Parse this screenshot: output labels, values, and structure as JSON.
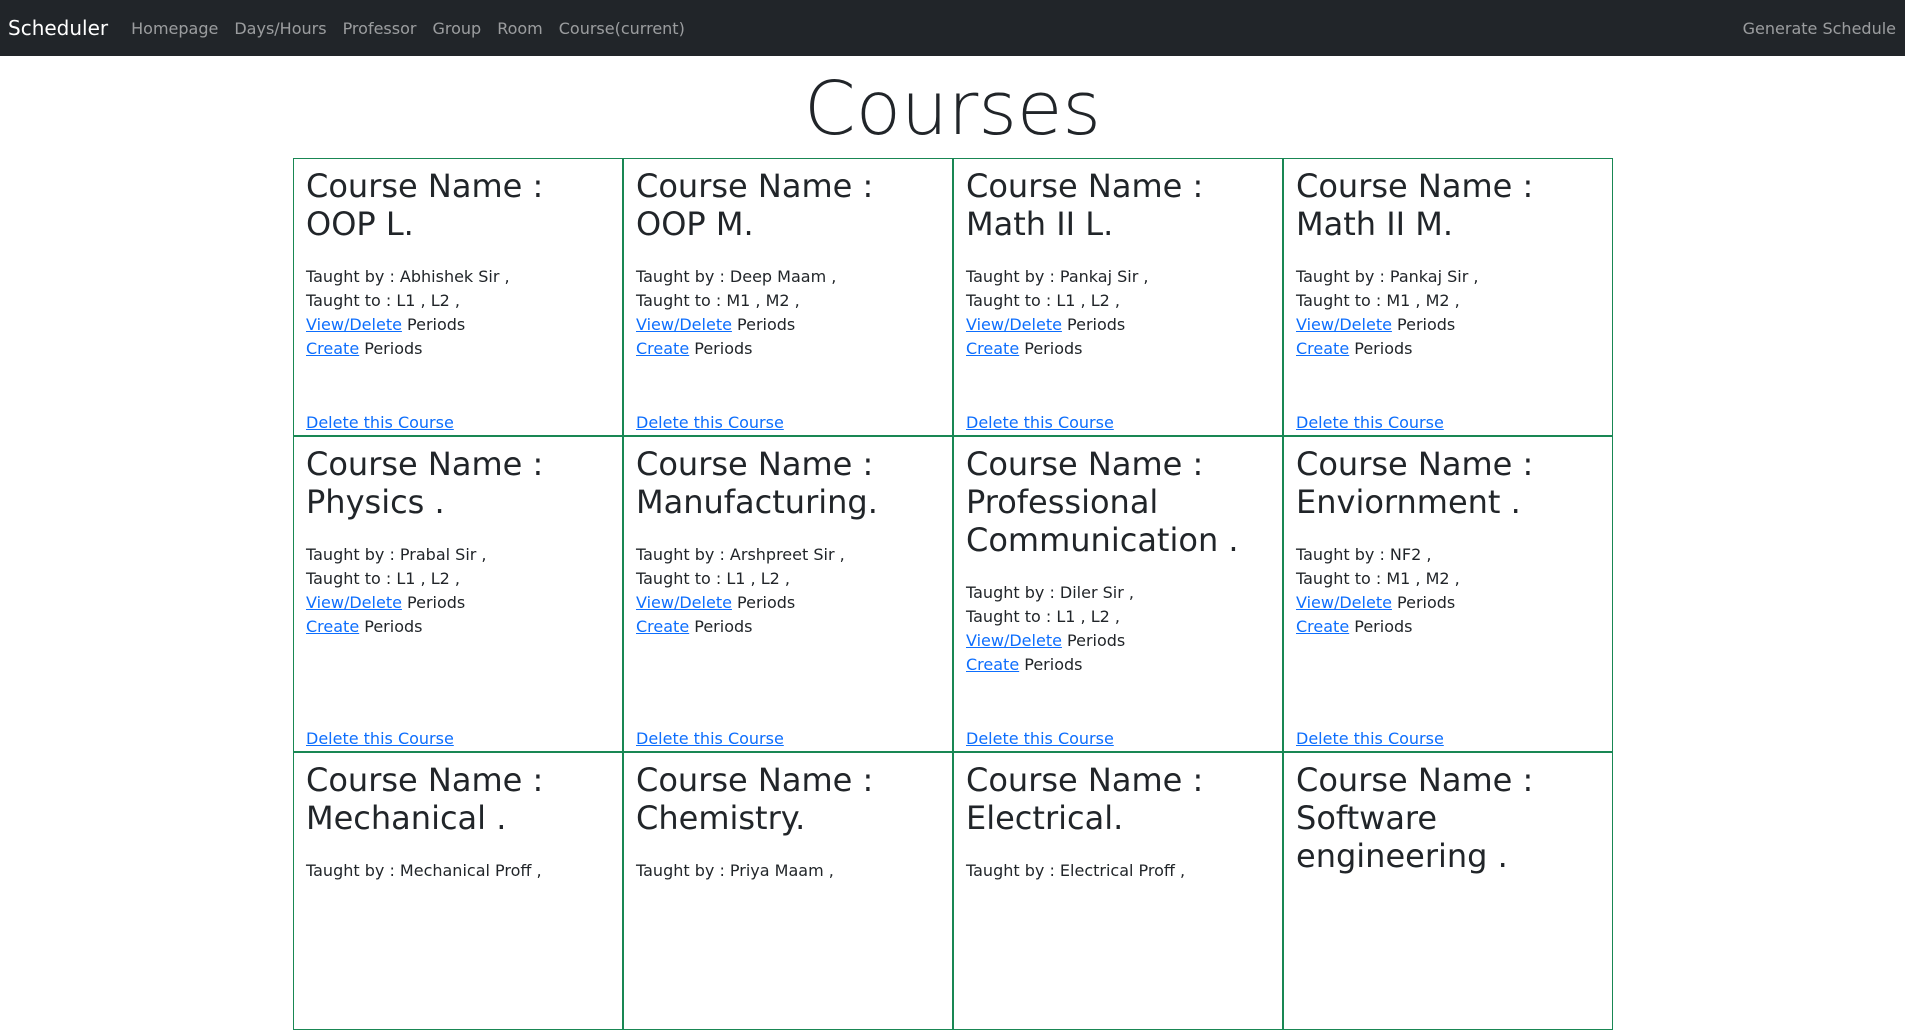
{
  "navbar": {
    "brand": "Scheduler",
    "links": [
      "Homepage",
      "Days/Hours",
      "Professor",
      "Group",
      "Room",
      "Course(current)"
    ],
    "right_link": "Generate Schedule"
  },
  "page": {
    "title": "Courses"
  },
  "labels": {
    "view_delete": "View/Delete",
    "create": "Create",
    "periods": " Periods",
    "delete_course": "Delete this Course"
  },
  "courses": [
    {
      "title": "Course Name : OOP L.",
      "taught_by": "Taught by : Abhishek Sir ,",
      "taught_to": "Taught to : L1 , L2 ,"
    },
    {
      "title": "Course Name : OOP M.",
      "taught_by": "Taught by : Deep Maam ,",
      "taught_to": "Taught to : M1 , M2 ,"
    },
    {
      "title": "Course Name : Math II L.",
      "taught_by": "Taught by : Pankaj Sir ,",
      "taught_to": "Taught to : L1 , L2 ,"
    },
    {
      "title": "Course Name : Math II M.",
      "taught_by": "Taught by : Pankaj Sir ,",
      "taught_to": "Taught to : M1 , M2 ,"
    },
    {
      "title": "Course Name : Physics .",
      "taught_by": "Taught by : Prabal Sir ,",
      "taught_to": "Taught to : L1 , L2 ,"
    },
    {
      "title": "Course Name : Manufacturing.",
      "taught_by": "Taught by : Arshpreet Sir ,",
      "taught_to": "Taught to : L1 , L2 ,"
    },
    {
      "title": "Course Name : Professional Communication .",
      "taught_by": "Taught by : Diler Sir ,",
      "taught_to": "Taught to : L1 , L2 ,"
    },
    {
      "title": "Course Name : Enviornment .",
      "taught_by": "Taught by : NF2 ,",
      "taught_to": "Taught to : M1 , M2 ,"
    },
    {
      "title": "Course Name : Mechanical .",
      "taught_by": "Taught by : Mechanical Proff ,",
      "taught_to": ""
    },
    {
      "title": "Course Name : Chemistry.",
      "taught_by": "Taught by : Priya Maam ,",
      "taught_to": ""
    },
    {
      "title": "Course Name : Electrical.",
      "taught_by": "Taught by : Electrical Proff ,",
      "taught_to": ""
    },
    {
      "title": "Course Name : Software engineering .",
      "taught_by": "",
      "taught_to": ""
    }
  ],
  "colors": {
    "navbar": "#212529",
    "card_border": "#198754",
    "link": "#0d6efd"
  }
}
